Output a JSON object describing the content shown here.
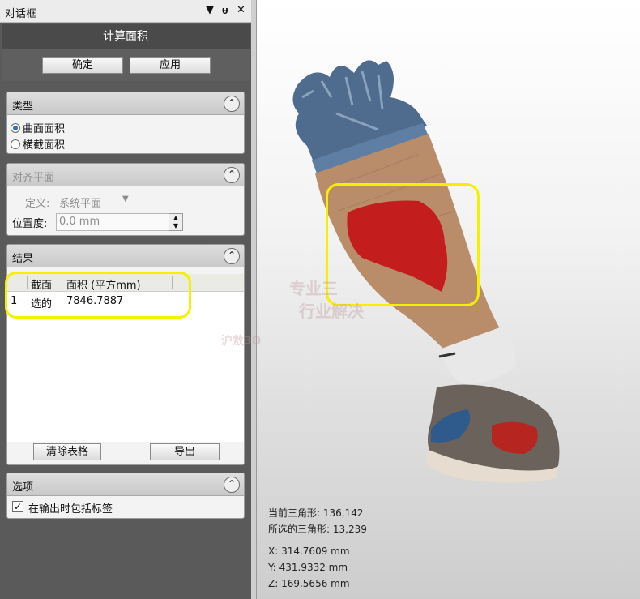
{
  "dialog": {
    "title": "对话框",
    "controls": {
      "pin": "▼",
      "dock": "ᵾ",
      "close": "✕"
    },
    "header": "计算面积",
    "ok_label": "确定",
    "apply_label": "应用"
  },
  "type_group": {
    "title": "类型",
    "collapse_icon": "⌃",
    "options": [
      {
        "label": "曲面面积",
        "selected": true
      },
      {
        "label": "横截面积",
        "selected": false
      }
    ]
  },
  "align_group": {
    "title": "对齐平面",
    "define_label": "定义:",
    "define_value": "系统平面",
    "position_label": "位置度:",
    "position_value": "0.0 mm"
  },
  "results_group": {
    "title": "结果",
    "columns": [
      "截面",
      "面积 (平方mm)"
    ],
    "rows": [
      {
        "index": "1",
        "section": "选的",
        "area": "7846.7887"
      }
    ],
    "clear_label": "清除表格",
    "export_label": "导出"
  },
  "options_group": {
    "title": "选项",
    "include_labels": "在输出时包括标签",
    "include_checked": true,
    "check_mark": "✓"
  },
  "viewport": {
    "current_triangles": "当前三角形: 136,142",
    "selected_triangles": "所选的三角形: 13,239",
    "coord_x": "X:  314.7609 mm",
    "coord_y": "Y:  431.9332 mm",
    "coord_z": "Z:  169.5656 mm",
    "watermark_line1": "专业三",
    "watermark_line2": "行业解决",
    "watermark_brand": "沪敖3D"
  },
  "colors": {
    "highlight": "#f4f000",
    "selection": "#c41d1d",
    "skin": "#b98d6a",
    "denim": "#4d6c93"
  }
}
